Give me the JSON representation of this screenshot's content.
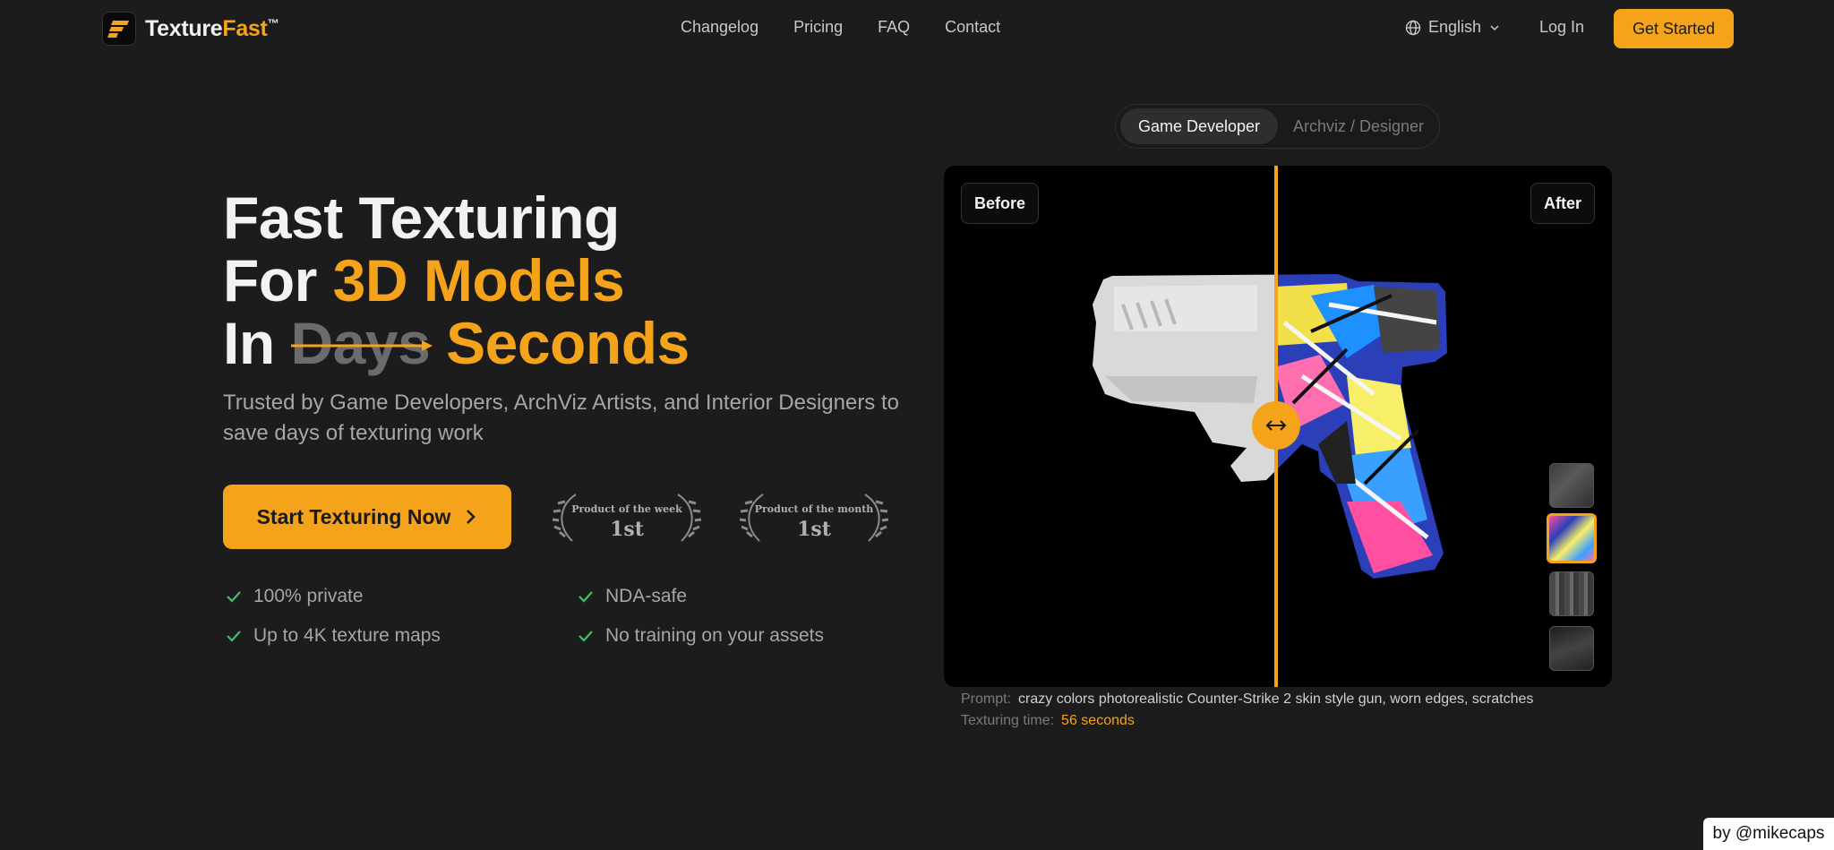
{
  "brand": {
    "name_part1": "Texture",
    "name_part2": "Fast",
    "trademark": "™"
  },
  "nav": {
    "links": [
      "Changelog",
      "Pricing",
      "FAQ",
      "Contact"
    ],
    "language": "English",
    "login": "Log In",
    "get_started": "Get Started"
  },
  "hero": {
    "line1": "Fast Texturing",
    "line2_prefix": "For",
    "line2_highlight": "3D Models",
    "line3_prefix": "In",
    "line3_struck": "Days",
    "line3_highlight": "Seconds",
    "subtitle": "Trusted by Game Developers, ArchViz Artists, and Interior Designers to save days of texturing work",
    "cta": "Start Texturing Now",
    "awards": [
      {
        "caption": "Product of the week",
        "rank": "1st"
      },
      {
        "caption": "Product of the month",
        "rank": "1st"
      }
    ],
    "features": [
      "100% private",
      "NDA-safe",
      "Up to 4K texture maps",
      "No training on your assets"
    ]
  },
  "showcase": {
    "tabs": [
      "Game Developer",
      "Archviz / Designer"
    ],
    "active_tab": "Game Developer",
    "before_label": "Before",
    "after_label": "After",
    "selected_thumbnail": 2,
    "prompt_label": "Prompt:",
    "prompt": "crazy colors photorealistic Counter-Strike 2 skin style gun, worn edges, scratches",
    "time_label": "Texturing time:",
    "time_value": "56 seconds"
  },
  "credit": "by @mikecaps",
  "colors": {
    "accent": "#f5a31a",
    "background": "#1c1c1c",
    "check": "#3fbf6a"
  }
}
